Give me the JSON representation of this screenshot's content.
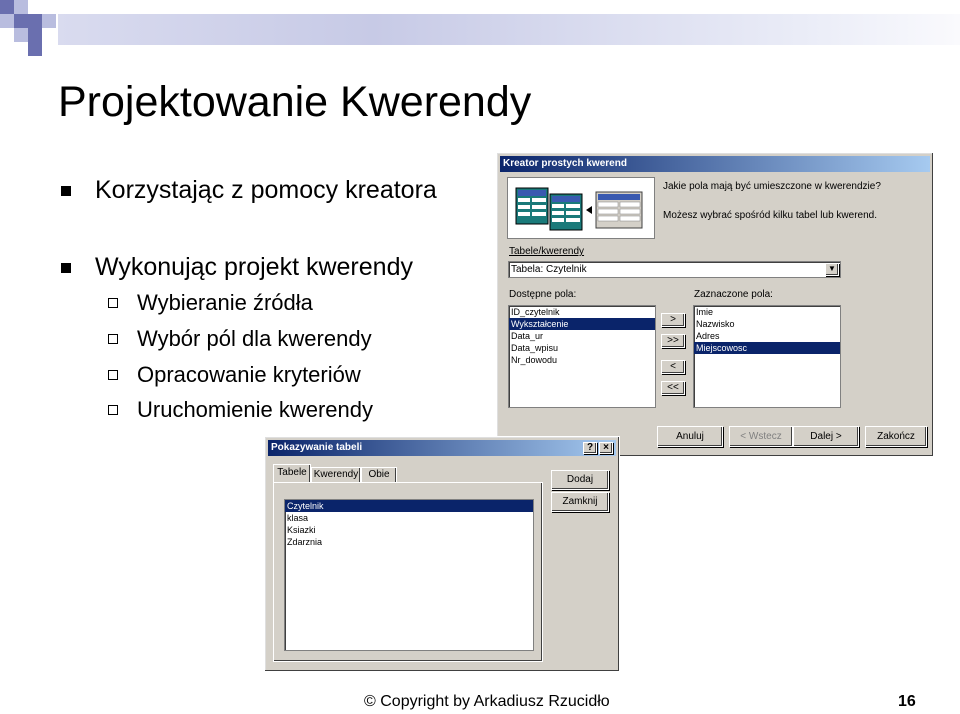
{
  "slide": {
    "title": "Projektowanie Kwerendy",
    "bullets": [
      {
        "text": "Korzystając z pomocy kreatora"
      },
      {
        "text": "Wykonując projekt kwerendy"
      }
    ],
    "sub_bullets": [
      {
        "text": "Wybieranie źródła"
      },
      {
        "text": "Wybór pól dla kwerendy"
      },
      {
        "text": "Opracowanie kryteriów"
      },
      {
        "text": "Uruchomienie kwerendy"
      }
    ],
    "footer": "© Copyright by Arkadiusz Rzucidło",
    "page_number": "16",
    "colors": {
      "deco_dark": "#6a6faf",
      "deco_light": "#b9bddf",
      "titlebar": "#0a246a"
    }
  },
  "wizard": {
    "title": "Kreator prostych kwerend",
    "question": "Jakie pola mają być umieszczone w kwerendzie?",
    "hint": "Możesz wybrać spośród kilku tabel lub kwerend.",
    "tables_label": "Tabele/kwerendy",
    "tables_value": "Tabela: Czytelnik",
    "available_label": "Dostępne pola:",
    "available_fields": [
      "ID_czytelnik",
      "Wykształcenie",
      "Data_ur",
      "Data_wpisu",
      "Nr_dowodu"
    ],
    "selected_label": "Zaznaczone pola:",
    "selected_fields": [
      "Imie",
      "Nazwisko",
      "Adres",
      "Miejscowosc"
    ],
    "move_buttons": [
      ">",
      ">>",
      "<",
      "<<"
    ],
    "buttons": {
      "cancel": "Anuluj",
      "back": "< Wstecz",
      "next": "Dalej >",
      "finish": "Zakończ"
    }
  },
  "show_table": {
    "title": "Pokazywanie tabeli",
    "help": "?",
    "close": "×",
    "tabs": [
      "Tabele",
      "Kwerendy",
      "Obie"
    ],
    "tables": [
      "Czytelnik",
      "klasa",
      "Ksiazki",
      "Zdarznia"
    ],
    "buttons": {
      "add": "Dodaj",
      "close": "Zamknij"
    }
  }
}
